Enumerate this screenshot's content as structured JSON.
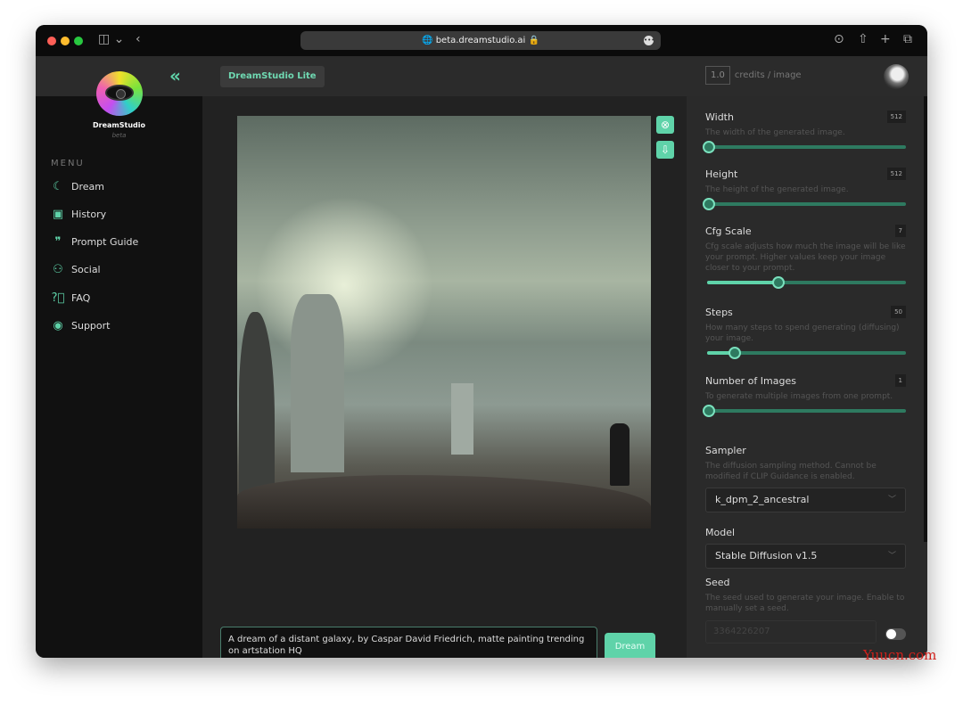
{
  "browser": {
    "url": "beta.dreamstudio.ai",
    "colors": {
      "close": "#ff5f57",
      "minimize": "#febc2e",
      "zoom": "#28c840"
    }
  },
  "header": {
    "brand_button": "DreamStudio Lite",
    "credits_value": "1.0",
    "credits_label": "credits / image"
  },
  "sidebar": {
    "logo_name": "DreamStudio",
    "logo_sub": "beta",
    "menu_label": "MENU",
    "items": [
      {
        "label": "Dream",
        "icon": "moon-stars-icon"
      },
      {
        "label": "History",
        "icon": "image-stack-icon"
      },
      {
        "label": "Prompt Guide",
        "icon": "quote-bubble-icon"
      },
      {
        "label": "Social",
        "icon": "users-icon"
      },
      {
        "label": "FAQ",
        "icon": "question-circle-icon"
      },
      {
        "label": "Support",
        "icon": "support-icon"
      }
    ]
  },
  "main": {
    "prompt": "A dream of a distant galaxy, by Caspar David Friedrich, matte painting trending on artstation HQ",
    "dream_button": "Dream"
  },
  "settings": {
    "width": {
      "title": "Width",
      "value": "512",
      "desc": "The width of the generated image.",
      "percent": 0
    },
    "height": {
      "title": "Height",
      "value": "512",
      "desc": "The height of the generated image.",
      "percent": 0
    },
    "cfg": {
      "title": "Cfg Scale",
      "value": "7",
      "desc": "Cfg scale adjusts how much the image will be like your prompt. Higher values keep your image closer to your prompt.",
      "percent": 35
    },
    "steps": {
      "title": "Steps",
      "value": "50",
      "desc": "How many steps to spend generating (diffusing) your image.",
      "percent": 13
    },
    "images": {
      "title": "Number of Images",
      "value": "1",
      "desc": "To generate multiple images from one prompt.",
      "percent": 0
    },
    "sampler": {
      "title": "Sampler",
      "desc": "The diffusion sampling method. Cannot be modified if CLIP Guidance is enabled.",
      "selected": "k_dpm_2_ancestral"
    },
    "model": {
      "title": "Model",
      "selected": "Stable Diffusion v1.5"
    },
    "seed": {
      "title": "Seed",
      "desc": "The seed used to generate your image. Enable to manually set a seed.",
      "placeholder": "3364226207",
      "enabled": false
    }
  },
  "accent": "#5fd3a9",
  "watermark": "Yuucn.com"
}
